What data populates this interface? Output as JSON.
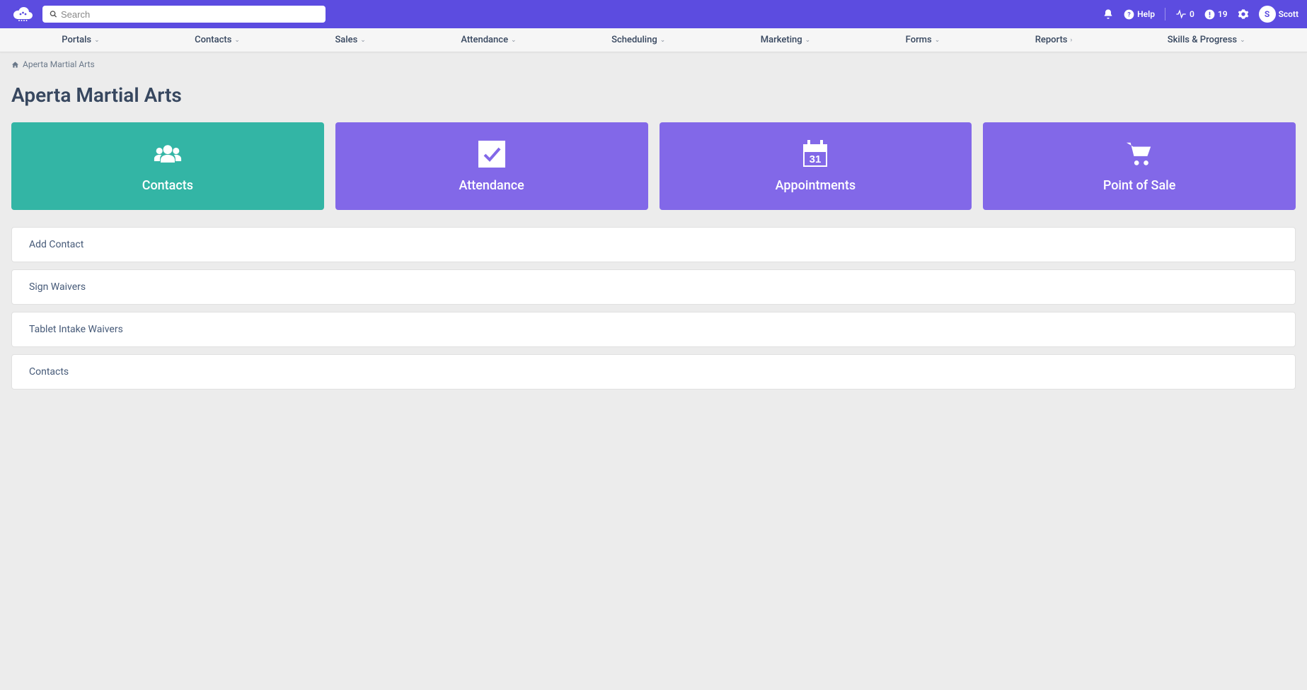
{
  "header": {
    "search_placeholder": "Search",
    "help_label": "Help",
    "pulse_count": "0",
    "alert_count": "19",
    "user_initial": "S",
    "user_name": "Scott"
  },
  "nav": {
    "items": [
      {
        "label": "Portals",
        "chevron": "down"
      },
      {
        "label": "Contacts",
        "chevron": "down"
      },
      {
        "label": "Sales",
        "chevron": "down"
      },
      {
        "label": "Attendance",
        "chevron": "down"
      },
      {
        "label": "Scheduling",
        "chevron": "down"
      },
      {
        "label": "Marketing",
        "chevron": "down"
      },
      {
        "label": "Forms",
        "chevron": "down"
      },
      {
        "label": "Reports",
        "chevron": "right"
      },
      {
        "label": "Skills & Progress",
        "chevron": "down"
      }
    ]
  },
  "breadcrumb": {
    "label": "Aperta Martial Arts"
  },
  "page": {
    "title": "Aperta Martial Arts"
  },
  "tiles": [
    {
      "label": "Contacts",
      "icon": "people-icon",
      "color": "green"
    },
    {
      "label": "Attendance",
      "icon": "check-icon",
      "color": "purple"
    },
    {
      "label": "Appointments",
      "icon": "calendar-icon",
      "color": "purple"
    },
    {
      "label": "Point of Sale",
      "icon": "cart-icon",
      "color": "purple"
    }
  ],
  "list_items": [
    {
      "label": "Add Contact"
    },
    {
      "label": "Sign Waivers"
    },
    {
      "label": "Tablet Intake Waivers"
    },
    {
      "label": "Contacts"
    }
  ]
}
